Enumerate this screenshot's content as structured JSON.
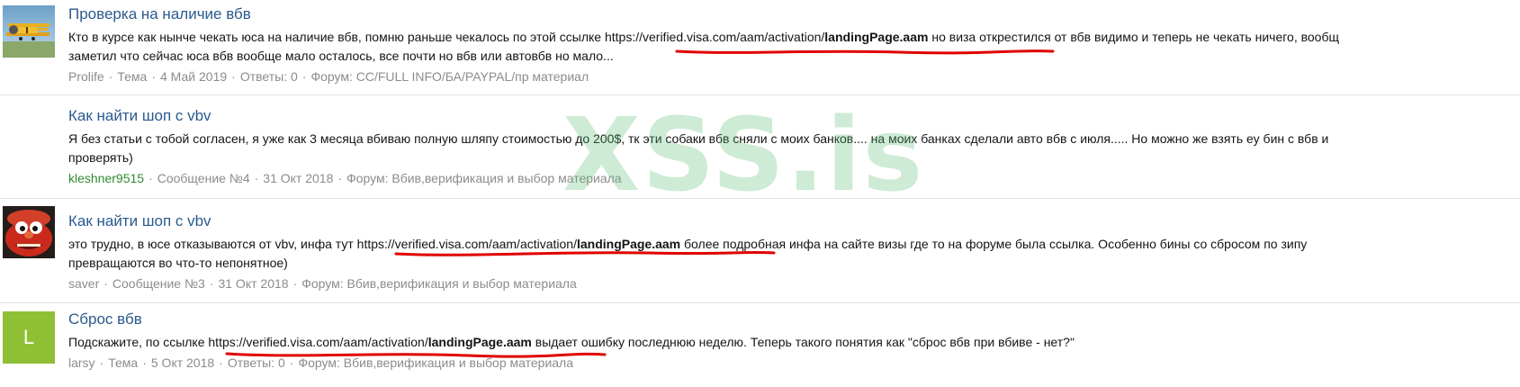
{
  "results": [
    {
      "title": "Проверка на наличие вбв",
      "snippet_line1_pre": "Кто в курсе как нынче чекать юса на наличие вбв, помню раньше чекалось по этой ссылке ",
      "link_prefix": "https://verified.visa.com/aam/activation/",
      "link_bold": "landingPage.aam",
      "snippet_line1_post": " но виза открестился от вбв видимо и теперь не чекать ничего, вообщ",
      "snippet_line2": "заметил что сейчас юса вбв вообще мало осталось, все почти но вбв или автовбв но мало...",
      "author": "Prolife",
      "kind": "Тема",
      "date": "4 Май 2019",
      "extra": "Ответы: 0",
      "forum": "Форум: CC/FULL INFO/БА/PAYPAL/пр материал"
    },
    {
      "title": "Как найти шоп с vbv",
      "snippet_line1": "Я без статьи с тобой согласен, я уже как 3 месяца вбиваю полную шляпу стоимостью до 200$, тк эти собаки вбв сняли с моих банков.... на моих банках сделали авто вбв с июля..... Но можно же взять еу бин с вбв и",
      "snippet_line2": "проверять)",
      "author": "kleshner9515",
      "kind": "Сообщение №4",
      "date": "31 Окт 2018",
      "forum": "Форум: Вбив,верификация и выбор материала"
    },
    {
      "title": "Как найти шоп с vbv",
      "snippet_line1_pre": "это трудно, в юсе отказываются от vbv, инфа тут ",
      "link_prefix": "https://verified.visa.com/aam/activation/",
      "link_bold": "landingPage.aam",
      "snippet_line1_post": " более подробная инфа на сайте визы где то на форуме была ссылка. Особенно бины со сбросом по зипу",
      "snippet_line2": "превращаются во что-то непонятное)",
      "author": "saver",
      "kind": "Сообщение №3",
      "date": "31 Окт 2018",
      "forum": "Форум: Вбив,верификация и выбор материала"
    },
    {
      "title": "Сброс вбв",
      "avatar_letter": "L",
      "snippet_line1_pre": "Подскажите, по ссылке ",
      "link_prefix": "https://verified.visa.com/aam/activation/",
      "link_bold": "landingPage.aam",
      "snippet_line1_post": " выдает ошибку последнюю неделю. Теперь такого понятия как \"сброс вбв при вбиве - нет?\"",
      "author": "larsy",
      "kind": "Тема",
      "date": "5 Окт 2018",
      "extra": "Ответы: 0",
      "forum": "Форум: Вбив,верификация и выбор материала"
    }
  ],
  "watermark": "XSS.is",
  "colors": {
    "title": "#2b5a8e",
    "meta": "#8c8c8c",
    "green_user": "#2f8b2f",
    "avatar_l": "#8fbf34",
    "underline": "#e00000"
  }
}
